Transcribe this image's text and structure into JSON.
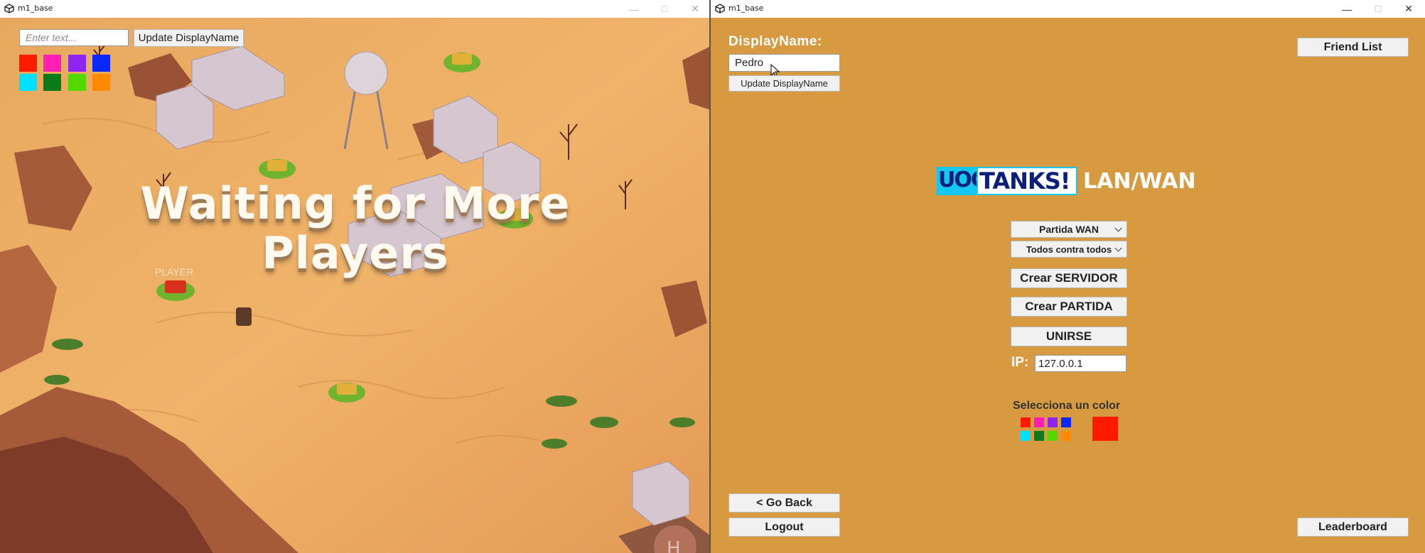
{
  "left_window": {
    "title": "m1_base",
    "text_input": {
      "placeholder": "Enter text...",
      "value": ""
    },
    "update_button": "Update DisplayName",
    "color_swatches": [
      "#ff1a00",
      "#ff1fb4",
      "#8e25f0",
      "#0b27ff",
      "#00e0ff",
      "#0a7a1b",
      "#52d900",
      "#ff8a00"
    ],
    "waiting_line1": "Waiting for More",
    "waiting_line2": "Players",
    "player_label": "PLAYER",
    "helipad_letter": "H"
  },
  "right_window": {
    "title": "m1_base",
    "display_name_label": "DisplayName:",
    "display_name_value": "Pedro",
    "update_button": "Update DisplayName",
    "friend_list_button": "Friend List",
    "logo": {
      "uoc": "UOC",
      "tanks": "TANKS!",
      "mode": "LAN/WAN"
    },
    "mode_select": "Partida WAN",
    "team_select": "Todos contra todos",
    "create_server_button": "Crear SERVIDOR",
    "create_game_button": "Crear PARTIDA",
    "join_button": "UNIRSE",
    "ip_label": "IP:",
    "ip_value": "127.0.0.1",
    "color_label": "Selecciona un color",
    "color_swatches": [
      "#ff1a00",
      "#ff1fb4",
      "#8e25f0",
      "#0b27ff",
      "#00e0ff",
      "#0a7a1b",
      "#52d900",
      "#ff8a00"
    ],
    "selected_color": "#ff1a00",
    "go_back_button": "< Go Back",
    "logout_button": "Logout",
    "leaderboard_button": "Leaderboard"
  },
  "window_controls": {
    "minimize": "—",
    "maximize": "☐",
    "close": "✕"
  }
}
